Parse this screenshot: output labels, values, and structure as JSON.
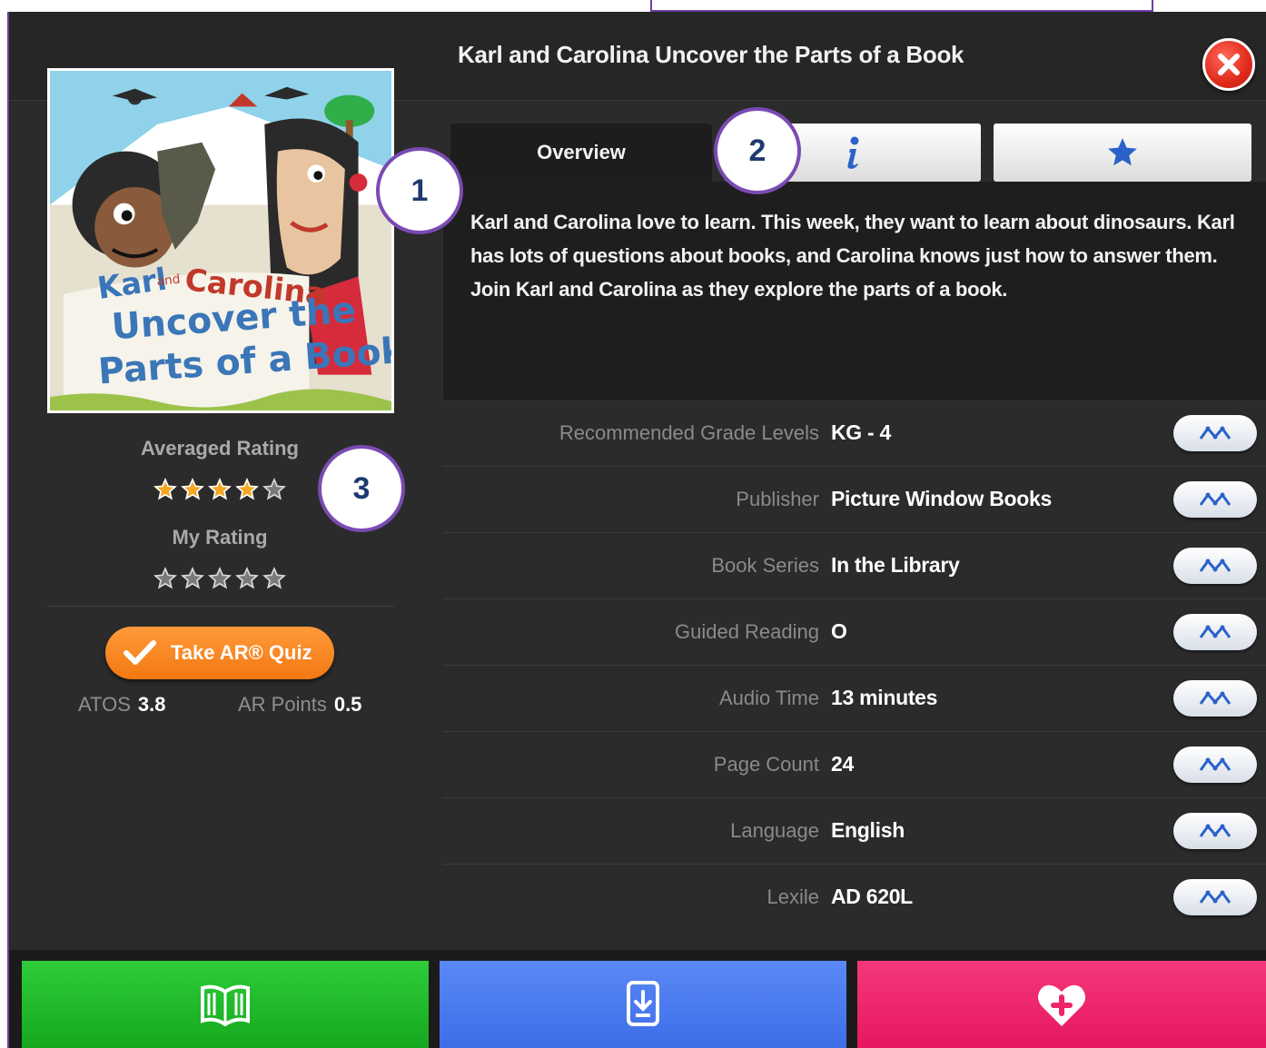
{
  "dialog": {
    "title": "Karl and Carolina Uncover the Parts of a Book",
    "close_icon": "close-icon"
  },
  "book": {
    "cover_title_line1": "Karl and Carolina",
    "cover_title_line2": "Uncover the",
    "cover_title_line3": "Parts of a Book"
  },
  "ratings": {
    "averaged_label": "Averaged Rating",
    "averaged_value": 4,
    "my_label": "My Rating",
    "my_value": 0,
    "max": 5
  },
  "quiz": {
    "button_label": "Take AR® Quiz",
    "atos_label": "ATOS",
    "atos_value": "3.8",
    "points_label": "AR Points",
    "points_value": "0.5"
  },
  "tabs": {
    "overview_label": "Overview",
    "info_icon": "info-icon",
    "star_icon": "star-icon"
  },
  "overview": {
    "description": "Karl and Carolina love to learn. This week, they want to learn about dinosaurs. Karl has lots of questions about books, and Carolina knows just how to answer them. Join Karl and Carolina as they explore the parts of a book."
  },
  "details": [
    {
      "label": "Recommended Grade Levels",
      "value": "KG - 4"
    },
    {
      "label": "Publisher",
      "value": "Picture Window Books"
    },
    {
      "label": "Book Series",
      "value": "In the Library"
    },
    {
      "label": "Guided Reading",
      "value": "O"
    },
    {
      "label": "Audio Time",
      "value": "13 minutes"
    },
    {
      "label": "Page Count",
      "value": "24"
    },
    {
      "label": "Language",
      "value": "English"
    },
    {
      "label": "Lexile",
      "value": "AD 620L"
    }
  ],
  "bottom_bar": {
    "read_icon": "open-book-icon",
    "download_icon": "download-icon",
    "favorite_icon": "heart-plus-icon"
  },
  "callouts": [
    "1",
    "2",
    "3"
  ],
  "colors": {
    "read": "#1fbb2b",
    "download": "#4a7cf0",
    "favorite": "#ee2468",
    "quiz": "#f58220",
    "callout_border": "#7a4bb3"
  }
}
